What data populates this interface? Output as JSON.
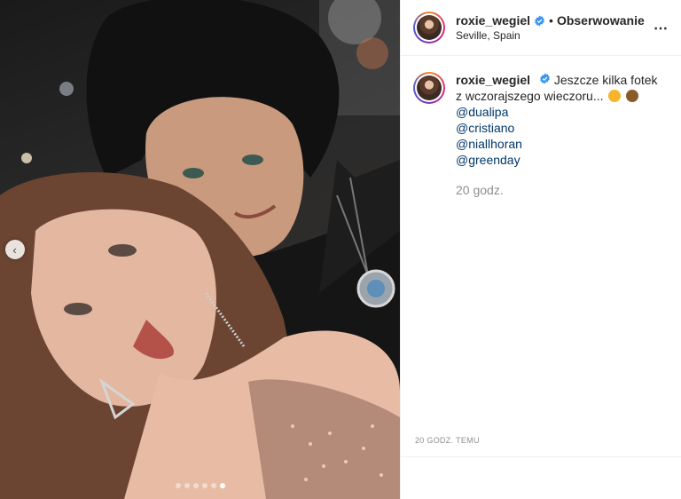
{
  "post": {
    "username": "roxie_wegiel",
    "separator": "•",
    "follow_label": "Obserwowanie",
    "location": "Seville, Spain",
    "more_icon": "⋯"
  },
  "caption": {
    "username": "roxie_wegiel",
    "text": "Jeszcze kilka fotek z wczorajszego wieczoru...",
    "emojis": [
      "heart-eyes-emoji",
      "see-no-evil-monkey-emoji"
    ],
    "mentions": [
      "@dualipa",
      "@cristiano",
      "@niallhoran",
      "@greenday"
    ],
    "time": "20 godz."
  },
  "footer": {
    "timestamp": "20 GODZ. TEMU"
  },
  "carousel": {
    "total": 6,
    "active_index": 5,
    "prev_icon": "‹"
  },
  "colors": {
    "verified": "#3897f0",
    "link": "#00376b",
    "muted": "#8e8e8e"
  }
}
